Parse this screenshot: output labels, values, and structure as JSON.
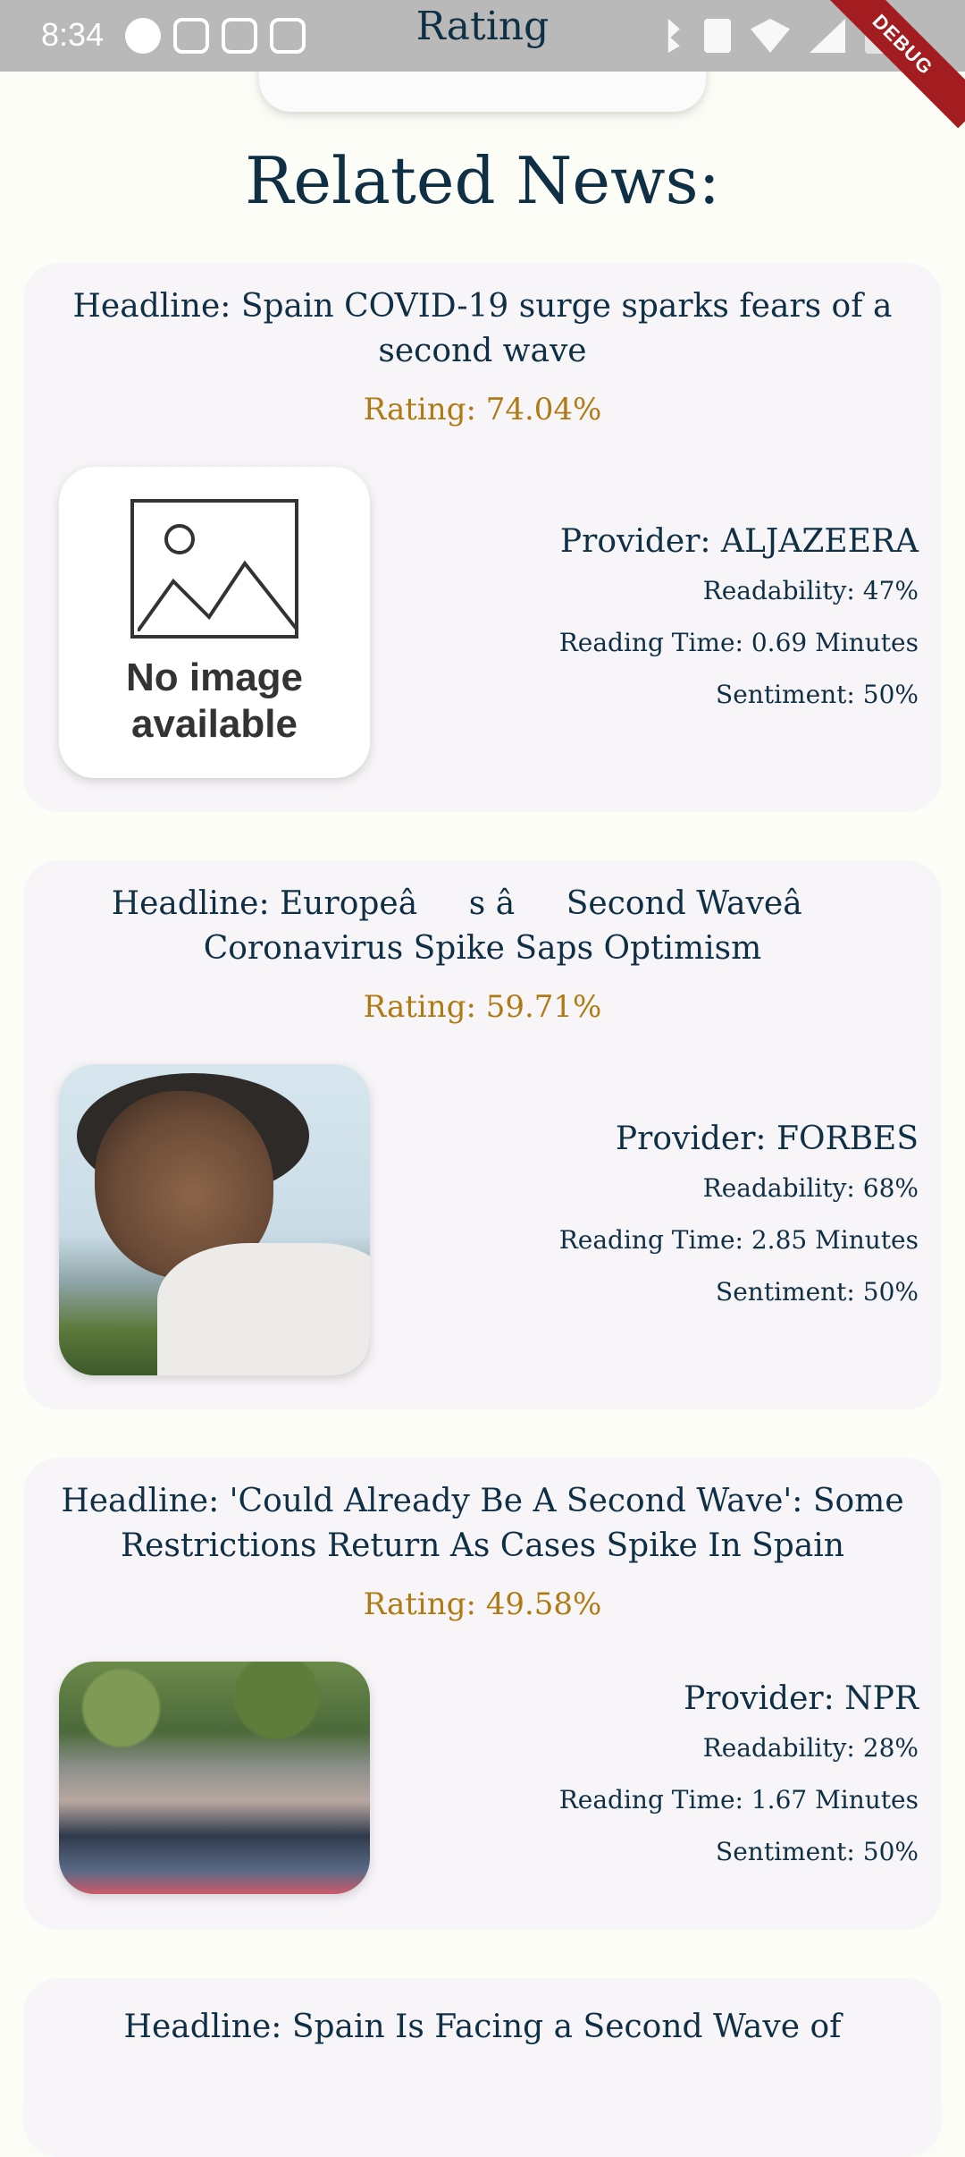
{
  "status_bar": {
    "time": "8:34",
    "left_icons": [
      "spotify-icon",
      "instagram-icon",
      "instagram-icon",
      "instagram-icon"
    ],
    "right_icons": [
      "bluetooth-icon",
      "vibrate-icon",
      "wifi-icon",
      "cellular-icon",
      "battery-icon"
    ],
    "debug_banner": "DEBUG"
  },
  "top_tab": {
    "title": "Rating"
  },
  "section": {
    "title": "Related News:"
  },
  "news": [
    {
      "headline": "Headline: Spain COVID-19 surge sparks fears of a second wave",
      "rating": "Rating: 74.04%",
      "image": "no-image-placeholder",
      "placeholder_text": "No image available",
      "provider": "Provider: ALJAZEERA",
      "readability": "Readability: 47%",
      "reading_time": "Reading Time: 0.69 Minutes",
      "sentiment": "Sentiment: 50%"
    },
    {
      "headline": "Headline: Europeâs âSecond Waveâ Coronavirus Spike Saps Optimism",
      "rating": "Rating: 59.71%",
      "image": "portrait-photo",
      "provider": "Provider: FORBES",
      "readability": "Readability: 68%",
      "reading_time": "Reading Time: 2.85 Minutes",
      "sentiment": "Sentiment: 50%"
    },
    {
      "headline": "Headline: 'Could Already Be A Second Wave': Some Restrictions Return As Cases Spike In Spain",
      "rating": "Rating: 49.58%",
      "image": "street-crowd-photo",
      "provider": "Provider: NPR",
      "readability": "Readability: 28%",
      "reading_time": "Reading Time: 1.67 Minutes",
      "sentiment": "Sentiment: 50%"
    },
    {
      "headline": "Headline: Spain Is Facing a Second Wave of"
    }
  ],
  "colors": {
    "text": "#0f2f45",
    "rating": "#b07a12",
    "card_bg": "#f8f5f9",
    "page_bg": "#fcfcf7",
    "debug_banner": "#a31c20"
  }
}
